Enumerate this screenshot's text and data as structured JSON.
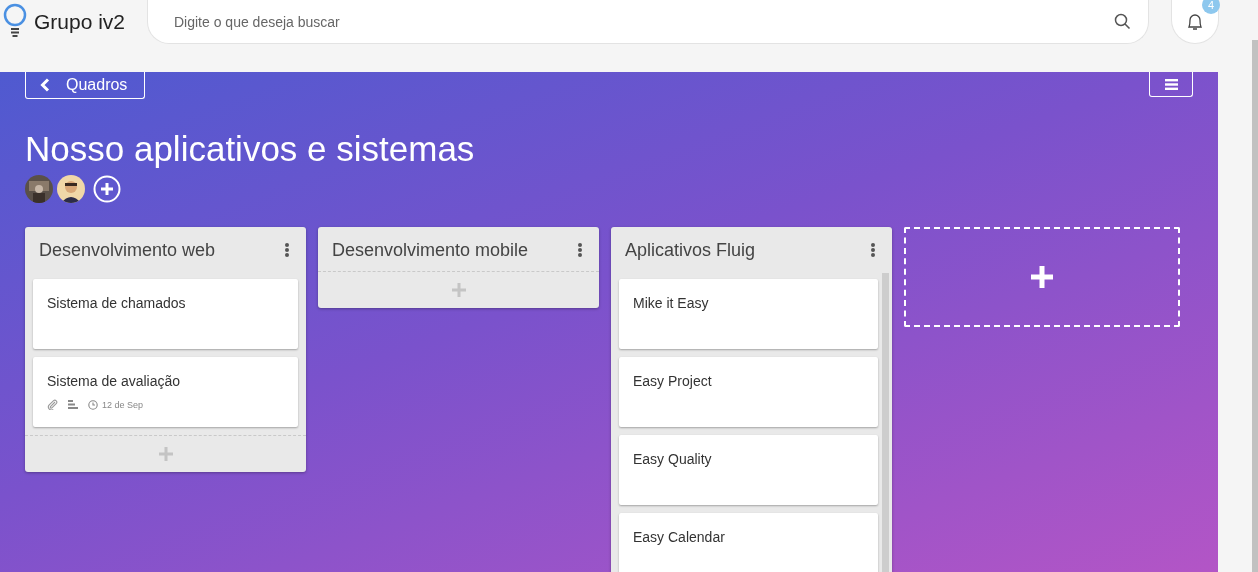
{
  "header": {
    "brand": "Grupo iv2",
    "search": {
      "placeholder": "Digite o que deseja buscar"
    },
    "notifications": {
      "count": "4"
    }
  },
  "board": {
    "back_label": "Quadros",
    "title": "Nosso aplicativos e sistemas"
  },
  "lists": [
    {
      "title": "Desenvolvimento web",
      "scrollable": false,
      "cards": [
        {
          "title": "Sistema de chamados"
        },
        {
          "title": "Sistema de avaliação",
          "attachment": true,
          "description": true,
          "date": "12 de Sep"
        }
      ]
    },
    {
      "title": "Desenvolvimento mobile",
      "scrollable": false
    },
    {
      "title": "Aplicativos Fluig",
      "scrollable": true,
      "cards": [
        {
          "title": "Mike it Easy"
        },
        {
          "title": "Easy Project"
        },
        {
          "title": "Easy Quality"
        },
        {
          "title": "Easy Calendar"
        }
      ]
    }
  ]
}
